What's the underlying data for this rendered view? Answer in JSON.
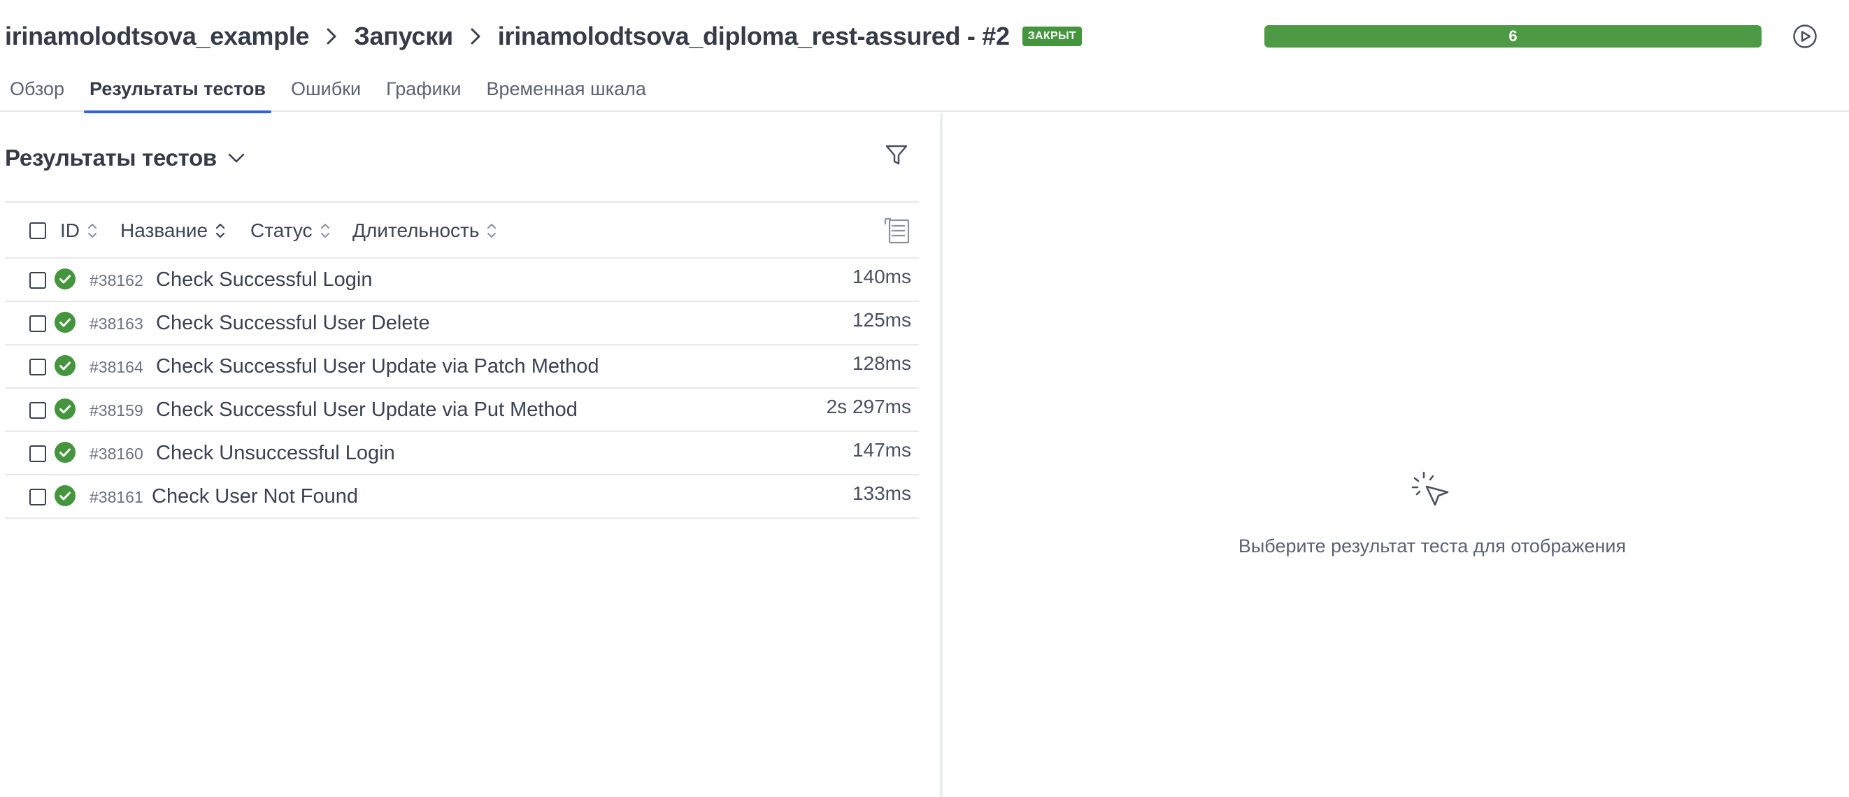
{
  "header": {
    "breadcrumbs": [
      "irinamolodtsova_example",
      "Запуски",
      "irinamolodtsova_diploma_rest-assured - #2"
    ],
    "status_badge": "ЗАКРЫТ",
    "progress": {
      "label": "6",
      "fraction": 1.0,
      "color": "#4c9a44"
    }
  },
  "tabs": [
    {
      "label": "Обзор",
      "active": false
    },
    {
      "label": "Результаты тестов",
      "active": true
    },
    {
      "label": "Ошибки",
      "active": false
    },
    {
      "label": "Графики",
      "active": false
    },
    {
      "label": "Временная шкала",
      "active": false
    }
  ],
  "panel": {
    "title": "Результаты тестов",
    "columns": {
      "id": "ID",
      "name": "Название",
      "status": "Статус",
      "duration": "Длительность"
    }
  },
  "results": [
    {
      "id": "#38162",
      "name": "Check Successful Login",
      "duration": "140ms",
      "status": "passed"
    },
    {
      "id": "#38163",
      "name": "Check Successful User Delete",
      "duration": "125ms",
      "status": "passed"
    },
    {
      "id": "#38164",
      "name": "Check Successful User Update via Patch Method",
      "duration": "128ms",
      "status": "passed"
    },
    {
      "id": "#38159",
      "name": "Check Successful User Update via Put Method",
      "duration": "2s 297ms",
      "status": "passed"
    },
    {
      "id": "#38160",
      "name": "Check Unsuccessful Login",
      "duration": "147ms",
      "status": "passed"
    },
    {
      "id": "#38161",
      "name": "Check User Not Found",
      "duration": "133ms",
      "status": "passed"
    }
  ],
  "empty_state": {
    "text": "Выберите результат теста для отображения",
    "icon": "cursor-click-icon"
  },
  "colors": {
    "passed": "#45953f",
    "accent": "#2e64d8",
    "badge": "#45953f"
  }
}
